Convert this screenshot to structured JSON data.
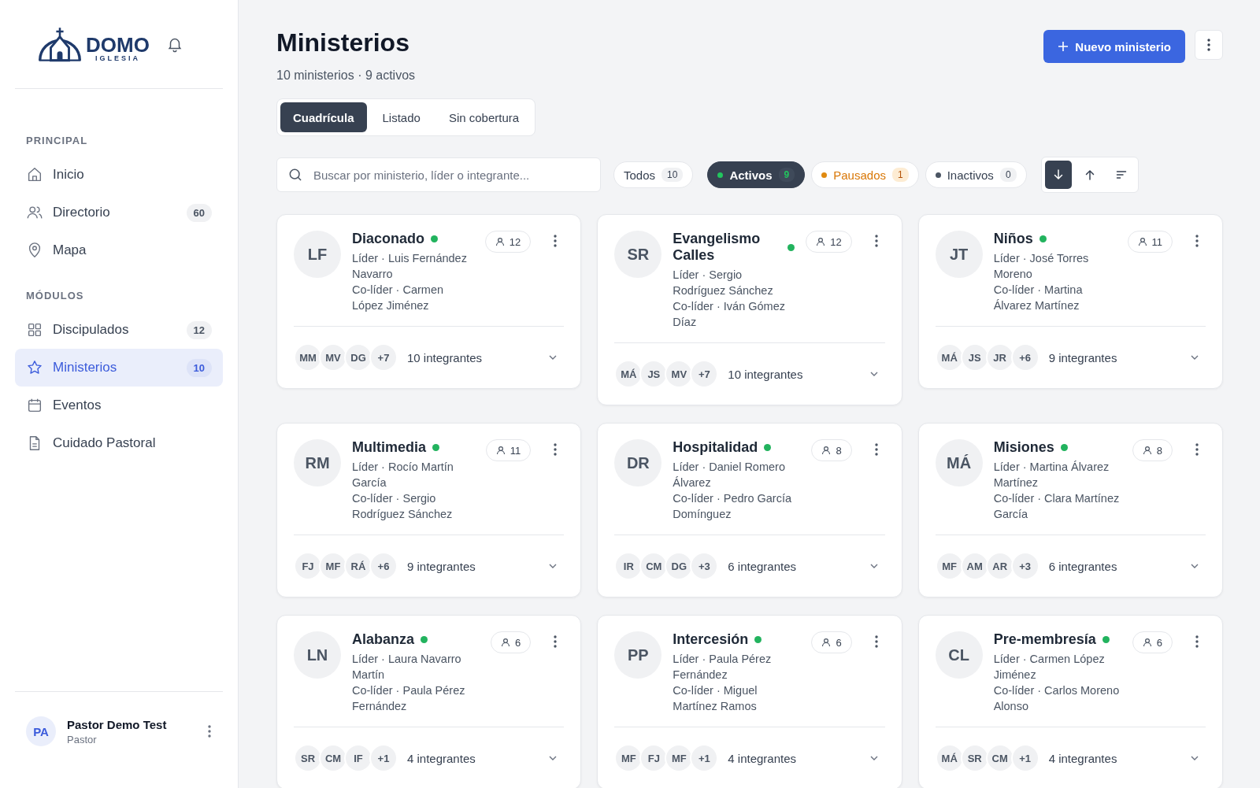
{
  "sidebar": {
    "logo": {
      "name": "DOMO",
      "subtitle": "IGLESIA"
    },
    "sections": [
      {
        "title": "PRINCIPAL",
        "items": [
          {
            "label": "Inicio",
            "kind": "home",
            "selected": false
          },
          {
            "label": "Directorio",
            "kind": "users",
            "count": "60",
            "selected": false
          },
          {
            "label": "Mapa",
            "kind": "pin",
            "selected": false
          }
        ]
      },
      {
        "title": "MÓDULOS",
        "items": [
          {
            "label": "Discipulados",
            "kind": "grid",
            "count": "12",
            "selected": false
          },
          {
            "label": "Ministerios",
            "kind": "star",
            "count": "10",
            "selected": true
          },
          {
            "label": "Eventos",
            "kind": "calendar",
            "selected": false
          },
          {
            "label": "Cuidado Pastoral",
            "kind": "doc",
            "selected": false
          }
        ]
      }
    ],
    "user": {
      "initials": "PA",
      "name": "Pastor Demo Test",
      "role": "Pastor"
    }
  },
  "header": {
    "title": "Ministerios",
    "subtitle": "10 ministerios · 9 activos",
    "new_button": "Nuevo ministerio"
  },
  "view_tabs": [
    {
      "label": "Cuadrícula",
      "selected": true
    },
    {
      "label": "Listado",
      "selected": false
    },
    {
      "label": "Sin cobertura",
      "selected": false
    }
  ],
  "search": {
    "placeholder": "Buscar por ministerio, líder o integrante..."
  },
  "filters": [
    {
      "label": "Todos",
      "count": "10",
      "kind": "all",
      "selected": false
    },
    {
      "label": "Activos",
      "count": "9",
      "kind": "active",
      "selected": true
    },
    {
      "label": "Pausados",
      "count": "1",
      "kind": "paused",
      "selected": false
    },
    {
      "label": "Inactivos",
      "count": "0",
      "kind": "inactive",
      "selected": false
    }
  ],
  "sort_buttons": [
    {
      "kind": "desc",
      "selected": true
    },
    {
      "kind": "asc",
      "selected": false
    },
    {
      "kind": "order",
      "selected": false
    }
  ],
  "ministries": [
    {
      "initials": "LF",
      "name": "Diaconado",
      "active": true,
      "count": "12",
      "leader": "Líder · Luis Fernández Navarro",
      "coleader": "Co-líder · Carmen López Jiménez",
      "members": [
        "MM",
        "MV",
        "DG"
      ],
      "more": "+7",
      "total": "10 integrantes"
    },
    {
      "initials": "SR",
      "name": "Evangelismo Calles",
      "active": true,
      "count": "12",
      "leader": "Líder · Sergio Rodríguez Sánchez",
      "coleader": "Co-líder · Iván Gómez Díaz",
      "members": [
        "MÁ",
        "JS",
        "MV"
      ],
      "more": "+7",
      "total": "10 integrantes"
    },
    {
      "initials": "JT",
      "name": "Niños",
      "active": true,
      "count": "11",
      "leader": "Líder · José Torres Moreno",
      "coleader": "Co-líder · Martina Álvarez Martínez",
      "members": [
        "MÁ",
        "JS",
        "JR"
      ],
      "more": "+6",
      "total": "9 integrantes"
    },
    {
      "initials": "RM",
      "name": "Multimedia",
      "active": true,
      "count": "11",
      "leader": "Líder · Rocío Martín García",
      "coleader": "Co-líder · Sergio Rodríguez Sánchez",
      "members": [
        "FJ",
        "MF",
        "RÁ"
      ],
      "more": "+6",
      "total": "9 integrantes"
    },
    {
      "initials": "DR",
      "name": "Hospitalidad",
      "active": true,
      "count": "8",
      "leader": "Líder · Daniel Romero Álvarez",
      "coleader": "Co-líder · Pedro García Domínguez",
      "members": [
        "IR",
        "CM",
        "DG"
      ],
      "more": "+3",
      "total": "6 integrantes"
    },
    {
      "initials": "MÁ",
      "name": "Misiones",
      "active": true,
      "count": "8",
      "leader": "Líder · Martina Álvarez Martínez",
      "coleader": "Co-líder · Clara Martínez García",
      "members": [
        "MF",
        "AM",
        "AR"
      ],
      "more": "+3",
      "total": "6 integrantes"
    },
    {
      "initials": "LN",
      "name": "Alabanza",
      "active": true,
      "count": "6",
      "leader": "Líder · Laura Navarro Martín",
      "coleader": "Co-líder · Paula Pérez Fernández",
      "members": [
        "SR",
        "CM",
        "IF"
      ],
      "more": "+1",
      "total": "4 integrantes"
    },
    {
      "initials": "PP",
      "name": "Intercesión",
      "active": true,
      "count": "6",
      "leader": "Líder · Paula Pérez Fernández",
      "coleader": "Co-líder · Miguel Martínez Ramos",
      "members": [
        "MF",
        "FJ",
        "MF"
      ],
      "more": "+1",
      "total": "4 integrantes"
    },
    {
      "initials": "CL",
      "name": "Pre-membresía",
      "active": true,
      "count": "6",
      "leader": "Líder · Carmen López Jiménez",
      "coleader": "Co-líder · Carlos Moreno Alonso",
      "members": [
        "MÁ",
        "SR",
        "CM"
      ],
      "more": "+1",
      "total": "4 integrantes"
    }
  ]
}
